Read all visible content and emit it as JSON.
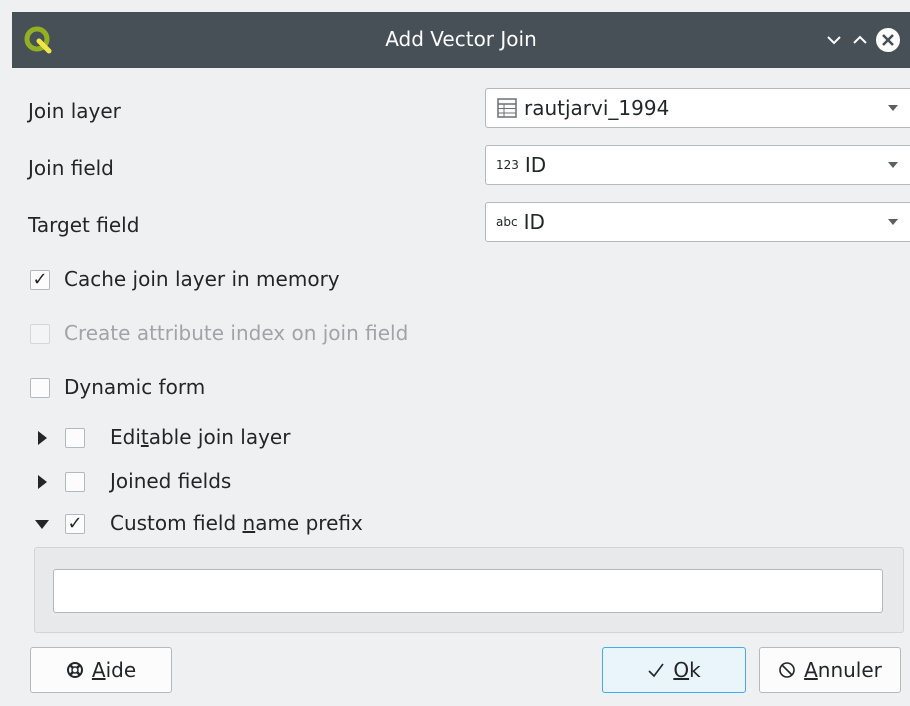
{
  "window": {
    "title": "Add Vector Join",
    "controls": [
      "minimize-icon",
      "maximize-icon",
      "close-icon"
    ]
  },
  "form": {
    "join_layer": {
      "label": "Join layer",
      "value": "rautjarvi_1994",
      "icon": "table-icon"
    },
    "join_field": {
      "label": "Join field",
      "type_badge": "123",
      "value": "ID"
    },
    "target_field": {
      "label": "Target field",
      "type_badge": "abc",
      "value": "ID"
    }
  },
  "options": {
    "cache": {
      "pre": "",
      "key": "",
      "post": "Cache join layer in memory",
      "checked": true,
      "enabled": true
    },
    "index": {
      "pre": "",
      "key": "",
      "post": "Create attribute index on join field",
      "checked": false,
      "enabled": false
    },
    "dynamic": {
      "pre": "",
      "key": "",
      "post": "Dynamic form",
      "checked": false,
      "enabled": true
    }
  },
  "groups": {
    "editable": {
      "pre": "Edi",
      "key": "t",
      "post": "able join layer",
      "checked": false,
      "expanded": false
    },
    "joined": {
      "pre": "",
      "key": "J",
      "post": "oined fields",
      "checked": false,
      "expanded": false
    },
    "prefix": {
      "pre": "Custom field ",
      "key": "n",
      "post": "ame prefix",
      "checked": true,
      "expanded": true
    }
  },
  "prefix_input": {
    "value": ""
  },
  "buttons": {
    "help": {
      "pre": "",
      "key": "A",
      "post": "ide",
      "icon": "lifebuoy-icon"
    },
    "ok": {
      "pre": "",
      "key": "O",
      "post": "k",
      "icon": "checkmark-icon"
    },
    "cancel": {
      "pre": "",
      "key": "A",
      "post": "nnuler",
      "icon": "cancel-icon"
    }
  },
  "colors": {
    "titlebar": "#475057",
    "window_bg": "#eff0f1",
    "accent": "#3daee9",
    "qgis_green": "#93b023"
  }
}
